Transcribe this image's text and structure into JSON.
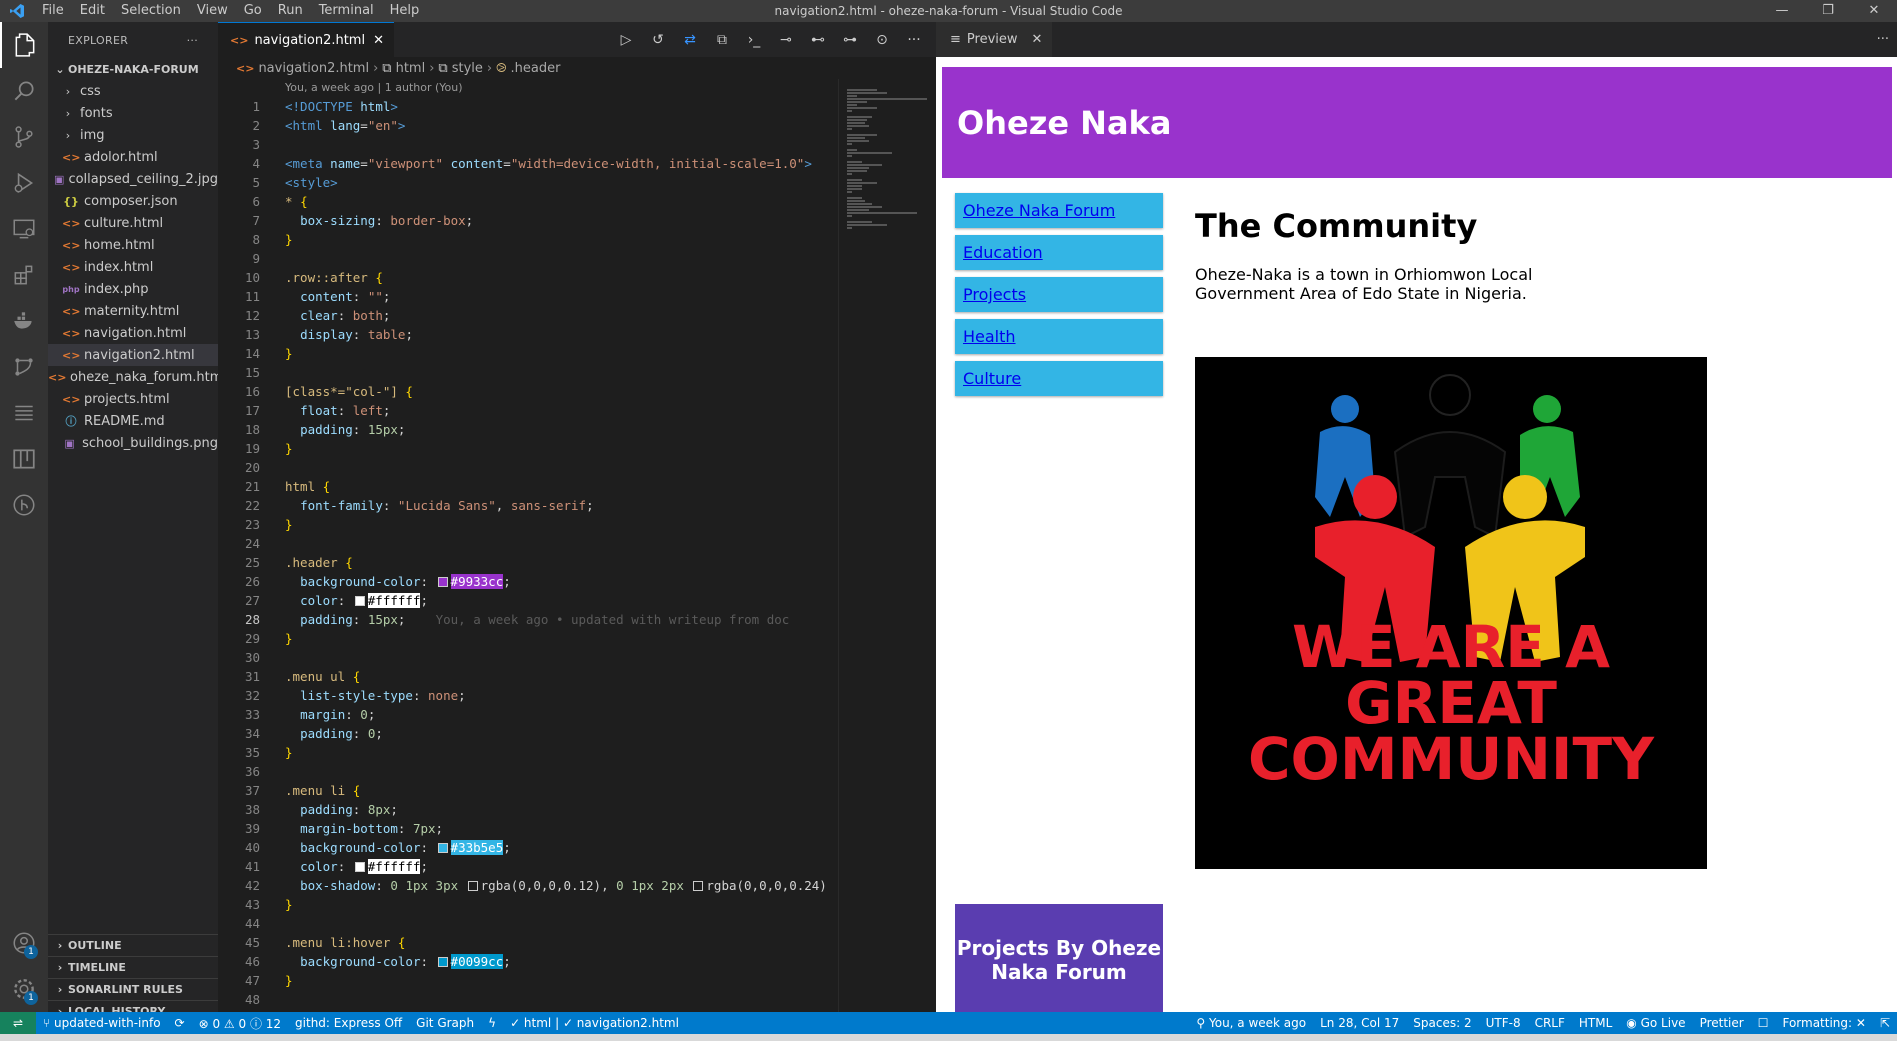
{
  "window": {
    "title": "navigation2.html - oheze-naka-forum - Visual Studio Code",
    "menu": [
      "File",
      "Edit",
      "Selection",
      "View",
      "Go",
      "Run",
      "Terminal",
      "Help"
    ]
  },
  "sidebar": {
    "header": "EXPLORER",
    "more": "···",
    "root": "OHEZE-NAKA-FORUM",
    "items": [
      {
        "label": "css",
        "type": "folder",
        "icon": "chevron-right-icon"
      },
      {
        "label": "fonts",
        "type": "folder",
        "icon": "chevron-right-icon"
      },
      {
        "label": "img",
        "type": "folder",
        "icon": "chevron-right-icon"
      },
      {
        "label": "adolor.html",
        "type": "html",
        "icon": "<>"
      },
      {
        "label": "collapsed_ceiling_2.jpg",
        "type": "image",
        "icon": "▣"
      },
      {
        "label": "composer.json",
        "type": "json",
        "icon": "{}"
      },
      {
        "label": "culture.html",
        "type": "html",
        "icon": "<>"
      },
      {
        "label": "home.html",
        "type": "html",
        "icon": "<>"
      },
      {
        "label": "index.html",
        "type": "html",
        "icon": "<>"
      },
      {
        "label": "index.php",
        "type": "php",
        "icon": "php"
      },
      {
        "label": "maternity.html",
        "type": "html",
        "icon": "<>"
      },
      {
        "label": "navigation.html",
        "type": "html",
        "icon": "<>"
      },
      {
        "label": "navigation2.html",
        "type": "html",
        "icon": "<>"
      },
      {
        "label": "oheze_naka_forum.html",
        "type": "html",
        "icon": "<>"
      },
      {
        "label": "projects.html",
        "type": "html",
        "icon": "<>"
      },
      {
        "label": "README.md",
        "type": "md",
        "icon": "ⓘ"
      },
      {
        "label": "school_buildings.png",
        "type": "image",
        "icon": "▣"
      }
    ],
    "sections": [
      "OUTLINE",
      "TIMELINE",
      "SONARLINT RULES",
      "LOCAL HISTORY"
    ]
  },
  "editor": {
    "tab_label": "navigation2.html",
    "tab_close": "✕",
    "breadcrumb": [
      "navigation2.html",
      "html",
      "style",
      ".header"
    ],
    "blame_header": "You, a week ago | 1 author (You)",
    "inline_blame": "You, a week ago • updated with writeup from doc",
    "current_line": 28,
    "swatch_colors": {
      "purple": "#9933cc",
      "white": "#ffffff",
      "blue": "#33b5e5",
      "teal": "#0099cc"
    }
  },
  "preview": {
    "tab_label": "Preview",
    "tab_close": "✕",
    "header": "Oheze Naka",
    "menu": [
      "Oheze Naka Forum",
      "Education",
      "Projects",
      "Health",
      "Culture"
    ],
    "heading": "The Community",
    "paragraph": "Oheze-Naka is a town in Orhiomwon Local Government Area of Edo State in Nigeria.",
    "image_text_1": "WE ARE A",
    "image_text_2": "GREAT",
    "image_text_3": "COMMUNITY",
    "aside": "Projects By Oheze Naka Forum",
    "colors": {
      "header": "#9933cc",
      "menu": "#33b5e5",
      "aside": "#5a3db0"
    }
  },
  "statusbar": {
    "branch": "updated-with-info",
    "problems": "⊗ 0 ⚠ 0 ⓘ 12",
    "githd": "githd: Express Off",
    "gitgraph": "Git Graph",
    "lang_path": "✓ html | ✓ navigation2.html",
    "blame": "You, a week ago",
    "position": "Ln 28, Col 17",
    "spaces": "Spaces: 2",
    "encoding": "UTF-8",
    "eol": "CRLF",
    "language": "HTML",
    "golive": "Go Live",
    "prettier": "Prettier",
    "formatting": "Formatting: ✕"
  }
}
